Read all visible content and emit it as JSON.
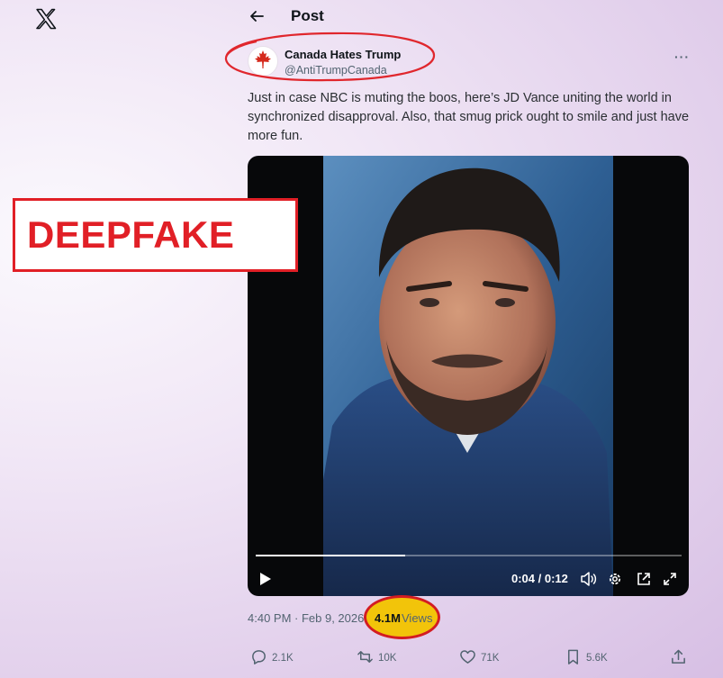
{
  "nav": {
    "logo_icon": "x-logo-icon"
  },
  "header": {
    "back_icon": "back-arrow-icon",
    "title": "Post"
  },
  "author": {
    "name": "Canada Hates Trump",
    "handle": "@AntiTrumpCanada",
    "avatar_icon": "maple-leaf-icon",
    "more_icon": "more-dots-icon",
    "more_label": "···"
  },
  "tweet": {
    "text": "Just in case NBC is muting the boos, here’s JD Vance uniting the world in synchronized disapproval. Also, that smug prick ought to smile and just have more fun."
  },
  "video": {
    "time": "0:04 / 0:12",
    "progress": 0.35,
    "controls": [
      "play-icon",
      "volume-icon",
      "settings-gear-icon",
      "popout-icon",
      "fullscreen-icon"
    ]
  },
  "annotation": {
    "label": "DEEPFAKE",
    "color": "#e11f26",
    "highlight_color": "#f2c40a"
  },
  "meta": {
    "timestamp": "4:40 PM · Feb 9, 2026 ·",
    "views_count": "4.1M",
    "views_label": "Views"
  },
  "actions": {
    "replies": "2.1K",
    "reposts": "10K",
    "likes": "71K",
    "bookmarks": "5.6K",
    "share_icon": "share-icon"
  }
}
